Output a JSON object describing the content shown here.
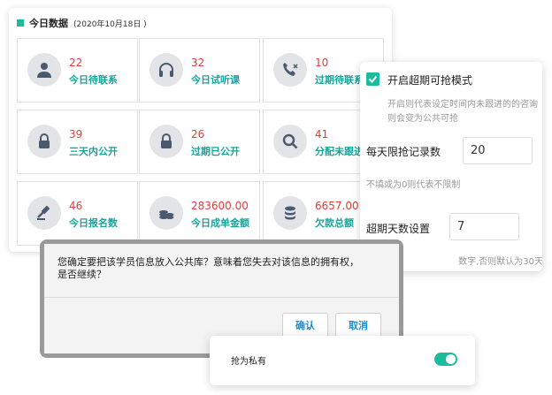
{
  "header": {
    "title": "今日数据",
    "date": "(2020年10月18日 )"
  },
  "cards": [
    {
      "num": "22",
      "label": "今日待联系",
      "icon": "user-icon"
    },
    {
      "num": "32",
      "label": "今日试听课",
      "icon": "headphones-icon"
    },
    {
      "num": "10",
      "label": "过期待联系",
      "icon": "phone-missed-icon"
    },
    {
      "num": "39",
      "label": "三天内公开",
      "icon": "lock-icon"
    },
    {
      "num": "26",
      "label": "过期已公开",
      "icon": "lock-icon"
    },
    {
      "num": "41",
      "label": "分配未跟进",
      "icon": "search-icon"
    },
    {
      "num": "46",
      "label": "今日报名数",
      "icon": "gavel-icon"
    },
    {
      "num": "283600.00",
      "label": "今日成单金额",
      "icon": "coins-icon"
    },
    {
      "num": "6657.00",
      "label": "欠款总额",
      "icon": "database-icon"
    }
  ],
  "settings": {
    "checkbox_label": "开启超期可抢模式",
    "checkbox_checked": true,
    "description": "开启则代表设定时间内未跟进的的咨询则会变为公共可抢",
    "daily_limit_label": "每天限抢记录数",
    "daily_limit_value": "20",
    "daily_limit_hint": "不填或为0则代表不限制",
    "overdue_days_label": "超期天数设置",
    "overdue_days_value": "7",
    "overdue_days_hint": "数字,否则默认为30天"
  },
  "dialog": {
    "message": "您确定要把该学员信息放入公共库？意味着您失去对该信息的拥有权，是否继续？",
    "confirm_label": "确认",
    "cancel_label": "取消"
  },
  "toggle": {
    "label": "抢为私有",
    "on": true
  },
  "colors": {
    "accent": "#1abc9c",
    "number": "#e43b3b",
    "label": "#1aa39a",
    "dialog_button": "#1a8fd8"
  }
}
